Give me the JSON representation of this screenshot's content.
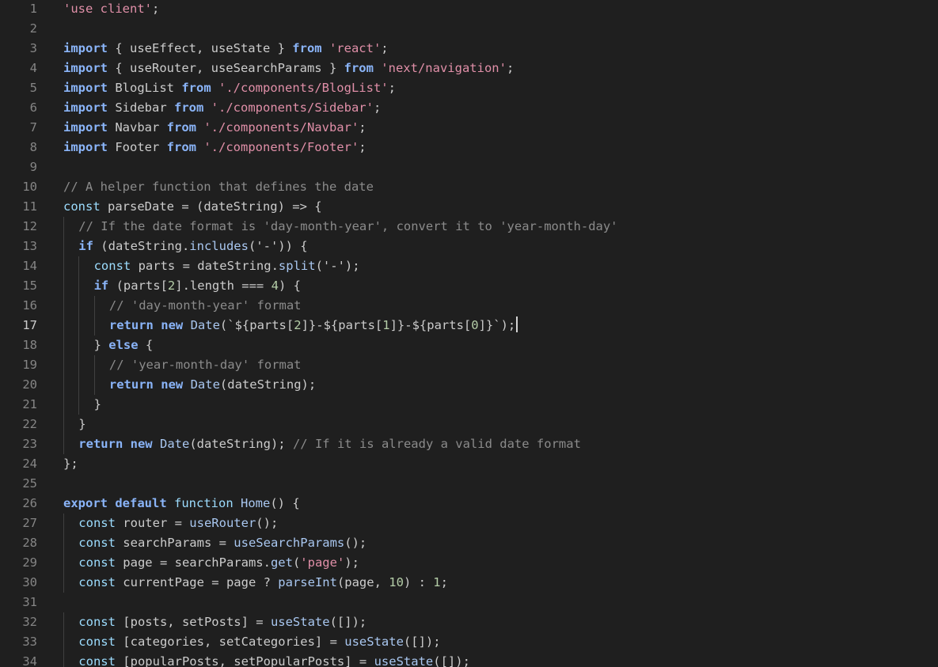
{
  "editor": {
    "current_line": 17,
    "lines": [
      {
        "n": "1",
        "indent": 0,
        "tokens": [
          {
            "t": "'use client'",
            "c": "str"
          },
          {
            "t": ";",
            "c": "tx"
          }
        ]
      },
      {
        "n": "2",
        "indent": 0,
        "tokens": []
      },
      {
        "n": "3",
        "indent": 0,
        "tokens": [
          {
            "t": "import",
            "c": "kwb"
          },
          {
            "t": " { useEffect, useState } ",
            "c": "tx"
          },
          {
            "t": "from",
            "c": "kwb"
          },
          {
            "t": " ",
            "c": "tx"
          },
          {
            "t": "'react'",
            "c": "str"
          },
          {
            "t": ";",
            "c": "tx"
          }
        ]
      },
      {
        "n": "4",
        "indent": 0,
        "tokens": [
          {
            "t": "import",
            "c": "kwb"
          },
          {
            "t": " { useRouter, useSearchParams } ",
            "c": "tx"
          },
          {
            "t": "from",
            "c": "kwb"
          },
          {
            "t": " ",
            "c": "tx"
          },
          {
            "t": "'next/navigation'",
            "c": "str"
          },
          {
            "t": ";",
            "c": "tx"
          }
        ]
      },
      {
        "n": "5",
        "indent": 0,
        "tokens": [
          {
            "t": "import",
            "c": "kwb"
          },
          {
            "t": " BlogList ",
            "c": "tx"
          },
          {
            "t": "from",
            "c": "kwb"
          },
          {
            "t": " ",
            "c": "tx"
          },
          {
            "t": "'./components/BlogList'",
            "c": "str"
          },
          {
            "t": ";",
            "c": "tx"
          }
        ]
      },
      {
        "n": "6",
        "indent": 0,
        "tokens": [
          {
            "t": "import",
            "c": "kwb"
          },
          {
            "t": " Sidebar ",
            "c": "tx"
          },
          {
            "t": "from",
            "c": "kwb"
          },
          {
            "t": " ",
            "c": "tx"
          },
          {
            "t": "'./components/Sidebar'",
            "c": "str"
          },
          {
            "t": ";",
            "c": "tx"
          }
        ]
      },
      {
        "n": "7",
        "indent": 0,
        "tokens": [
          {
            "t": "import",
            "c": "kwb"
          },
          {
            "t": " Navbar ",
            "c": "tx"
          },
          {
            "t": "from",
            "c": "kwb"
          },
          {
            "t": " ",
            "c": "tx"
          },
          {
            "t": "'./components/Navbar'",
            "c": "str"
          },
          {
            "t": ";",
            "c": "tx"
          }
        ]
      },
      {
        "n": "8",
        "indent": 0,
        "tokens": [
          {
            "t": "import",
            "c": "kwb"
          },
          {
            "t": " Footer ",
            "c": "tx"
          },
          {
            "t": "from",
            "c": "kwb"
          },
          {
            "t": " ",
            "c": "tx"
          },
          {
            "t": "'./components/Footer'",
            "c": "str"
          },
          {
            "t": ";",
            "c": "tx"
          }
        ]
      },
      {
        "n": "9",
        "indent": 0,
        "tokens": []
      },
      {
        "n": "10",
        "indent": 0,
        "tokens": [
          {
            "t": "// A helper function that defines the date",
            "c": "com"
          }
        ]
      },
      {
        "n": "11",
        "indent": 0,
        "tokens": [
          {
            "t": "const",
            "c": "kw"
          },
          {
            "t": " parseDate = (dateString) => {",
            "c": "tx"
          }
        ]
      },
      {
        "n": "12",
        "indent": 1,
        "tokens": [
          {
            "t": "// If the date format is 'day-month-year', convert it to 'year-month-day'",
            "c": "com"
          }
        ]
      },
      {
        "n": "13",
        "indent": 1,
        "tokens": [
          {
            "t": "if",
            "c": "kwb"
          },
          {
            "t": " (dateString.",
            "c": "tx"
          },
          {
            "t": "includes",
            "c": "fn"
          },
          {
            "t": "(",
            "c": "tx"
          },
          {
            "t": "'-'",
            "c": "str2"
          },
          {
            "t": ")) {",
            "c": "tx"
          }
        ]
      },
      {
        "n": "14",
        "indent": 2,
        "tokens": [
          {
            "t": "const",
            "c": "kw"
          },
          {
            "t": " parts = dateString.",
            "c": "tx"
          },
          {
            "t": "split",
            "c": "fn"
          },
          {
            "t": "(",
            "c": "tx"
          },
          {
            "t": "'-'",
            "c": "str2"
          },
          {
            "t": ");",
            "c": "tx"
          }
        ]
      },
      {
        "n": "15",
        "indent": 2,
        "tokens": [
          {
            "t": "if",
            "c": "kwb"
          },
          {
            "t": " (parts[",
            "c": "tx"
          },
          {
            "t": "2",
            "c": "num"
          },
          {
            "t": "].length === ",
            "c": "tx"
          },
          {
            "t": "4",
            "c": "num"
          },
          {
            "t": ") {",
            "c": "tx"
          }
        ]
      },
      {
        "n": "16",
        "indent": 3,
        "tokens": [
          {
            "t": "// 'day-month-year' format",
            "c": "com"
          }
        ]
      },
      {
        "n": "17",
        "indent": 3,
        "cursor": true,
        "tokens": [
          {
            "t": "return",
            "c": "kwb"
          },
          {
            "t": " ",
            "c": "tx"
          },
          {
            "t": "new",
            "c": "kwb"
          },
          {
            "t": " ",
            "c": "tx"
          },
          {
            "t": "Date",
            "c": "fn"
          },
          {
            "t": "(`${parts[",
            "c": "tx"
          },
          {
            "t": "2",
            "c": "num"
          },
          {
            "t": "]}-${parts[",
            "c": "tx"
          },
          {
            "t": "1",
            "c": "num"
          },
          {
            "t": "]}-${parts[",
            "c": "tx"
          },
          {
            "t": "0",
            "c": "num"
          },
          {
            "t": "]}`);",
            "c": "tx"
          }
        ]
      },
      {
        "n": "18",
        "indent": 2,
        "tokens": [
          {
            "t": "} ",
            "c": "tx"
          },
          {
            "t": "else",
            "c": "kwb"
          },
          {
            "t": " {",
            "c": "tx"
          }
        ]
      },
      {
        "n": "19",
        "indent": 3,
        "tokens": [
          {
            "t": "// 'year-month-day' format",
            "c": "com"
          }
        ]
      },
      {
        "n": "20",
        "indent": 3,
        "tokens": [
          {
            "t": "return",
            "c": "kwb"
          },
          {
            "t": " ",
            "c": "tx"
          },
          {
            "t": "new",
            "c": "kwb"
          },
          {
            "t": " ",
            "c": "tx"
          },
          {
            "t": "Date",
            "c": "fn"
          },
          {
            "t": "(dateString);",
            "c": "tx"
          }
        ]
      },
      {
        "n": "21",
        "indent": 2,
        "tokens": [
          {
            "t": "}",
            "c": "tx"
          }
        ]
      },
      {
        "n": "22",
        "indent": 1,
        "tokens": [
          {
            "t": "}",
            "c": "tx"
          }
        ]
      },
      {
        "n": "23",
        "indent": 1,
        "tokens": [
          {
            "t": "return",
            "c": "kwb"
          },
          {
            "t": " ",
            "c": "tx"
          },
          {
            "t": "new",
            "c": "kwb"
          },
          {
            "t": " ",
            "c": "tx"
          },
          {
            "t": "Date",
            "c": "fn"
          },
          {
            "t": "(dateString); ",
            "c": "tx"
          },
          {
            "t": "// If it is already a valid date format",
            "c": "com"
          }
        ]
      },
      {
        "n": "24",
        "indent": 0,
        "tokens": [
          {
            "t": "};",
            "c": "tx"
          }
        ]
      },
      {
        "n": "25",
        "indent": 0,
        "tokens": []
      },
      {
        "n": "26",
        "indent": 0,
        "tokens": [
          {
            "t": "export",
            "c": "kwb"
          },
          {
            "t": " ",
            "c": "tx"
          },
          {
            "t": "default",
            "c": "kwb"
          },
          {
            "t": " ",
            "c": "tx"
          },
          {
            "t": "function",
            "c": "kw"
          },
          {
            "t": " ",
            "c": "tx"
          },
          {
            "t": "Home",
            "c": "fn"
          },
          {
            "t": "() {",
            "c": "tx"
          }
        ]
      },
      {
        "n": "27",
        "indent": 1,
        "tokens": [
          {
            "t": "const",
            "c": "kw"
          },
          {
            "t": " router = ",
            "c": "tx"
          },
          {
            "t": "useRouter",
            "c": "fn"
          },
          {
            "t": "();",
            "c": "tx"
          }
        ]
      },
      {
        "n": "28",
        "indent": 1,
        "tokens": [
          {
            "t": "const",
            "c": "kw"
          },
          {
            "t": " searchParams = ",
            "c": "tx"
          },
          {
            "t": "useSearchParams",
            "c": "fn"
          },
          {
            "t": "();",
            "c": "tx"
          }
        ]
      },
      {
        "n": "29",
        "indent": 1,
        "tokens": [
          {
            "t": "const",
            "c": "kw"
          },
          {
            "t": " page = searchParams.",
            "c": "tx"
          },
          {
            "t": "get",
            "c": "fn"
          },
          {
            "t": "(",
            "c": "tx"
          },
          {
            "t": "'page'",
            "c": "str"
          },
          {
            "t": ");",
            "c": "tx"
          }
        ]
      },
      {
        "n": "30",
        "indent": 1,
        "tokens": [
          {
            "t": "const",
            "c": "kw"
          },
          {
            "t": " currentPage = page ? ",
            "c": "tx"
          },
          {
            "t": "parseInt",
            "c": "fn"
          },
          {
            "t": "(page, ",
            "c": "tx"
          },
          {
            "t": "10",
            "c": "num"
          },
          {
            "t": ") : ",
            "c": "tx"
          },
          {
            "t": "1",
            "c": "num"
          },
          {
            "t": ";",
            "c": "tx"
          }
        ]
      },
      {
        "n": "31",
        "indent": 0,
        "tokens": []
      },
      {
        "n": "32",
        "indent": 1,
        "tokens": [
          {
            "t": "const",
            "c": "kw"
          },
          {
            "t": " [posts, setPosts] = ",
            "c": "tx"
          },
          {
            "t": "useState",
            "c": "fn"
          },
          {
            "t": "([]);",
            "c": "tx"
          }
        ]
      },
      {
        "n": "33",
        "indent": 1,
        "tokens": [
          {
            "t": "const",
            "c": "kw"
          },
          {
            "t": " [categories, setCategories] = ",
            "c": "tx"
          },
          {
            "t": "useState",
            "c": "fn"
          },
          {
            "t": "([]);",
            "c": "tx"
          }
        ]
      },
      {
        "n": "34",
        "indent": 1,
        "tokens": [
          {
            "t": "const",
            "c": "kw"
          },
          {
            "t": " [popularPosts, setPopularPosts] = ",
            "c": "tx"
          },
          {
            "t": "useState",
            "c": "fn"
          },
          {
            "t": "([]);",
            "c": "tx"
          }
        ]
      }
    ]
  }
}
